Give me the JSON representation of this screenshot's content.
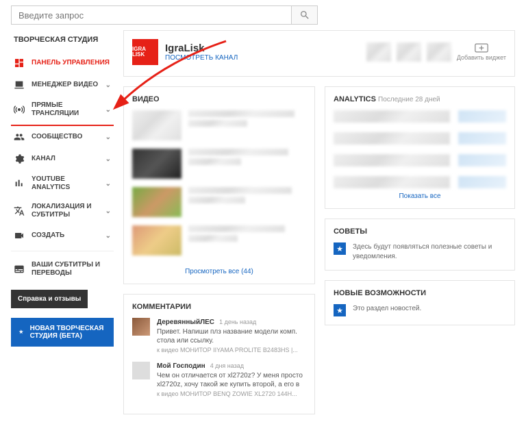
{
  "search": {
    "placeholder": "Введите запрос"
  },
  "sidebar": {
    "title": "ТВОРЧЕСКАЯ СТУДИЯ",
    "items": [
      {
        "label": "ПАНЕЛЬ УПРАВЛЕНИЯ"
      },
      {
        "label": "МЕНЕДЖЕР ВИДЕО"
      },
      {
        "label": "ПРЯМЫЕ ТРАНСЛЯЦИИ"
      },
      {
        "label": "СООБЩЕСТВО"
      },
      {
        "label": "КАНАЛ"
      },
      {
        "label": "YOUTUBE ANALYTICS"
      },
      {
        "label": "ЛОКАЛИЗАЦИЯ И СУБТИТРЫ"
      },
      {
        "label": "СОЗДАТЬ"
      },
      {
        "label": "ВАШИ СУБТИТРЫ И ПЕРЕВОДЫ"
      }
    ],
    "feedback": "Справка и отзывы",
    "newstudio": "НОВАЯ ТВОРЧЕСКАЯ СТУДИЯ (БЕТА)"
  },
  "channel": {
    "logo": "IGRA LISK",
    "name": "IgraLisk",
    "view_link": "ПОСМОТРЕТЬ КАНАЛ",
    "widget_label": "Добавить виджет"
  },
  "videos": {
    "title": "ВИДЕО",
    "view_all": "Просмотреть все (44)"
  },
  "analytics": {
    "title": "ANALYTICS",
    "subtitle": "Последние 28 дней",
    "show_all": "Показать все"
  },
  "tips": {
    "title": "СОВЕТЫ",
    "text": "Здесь будут появляться полезные советы и уведомления."
  },
  "news": {
    "title": "НОВЫЕ ВОЗМОЖНОСТИ",
    "text": "Это раздел новостей."
  },
  "comments": {
    "title": "КОММЕНТАРИИ",
    "items": [
      {
        "author": "ДеревянныйЛЕС",
        "time": "1 день назад",
        "text": "Привет. Напиши плз название модели комп. стола или ссылку.",
        "ref": "к видео МОНИТОР IIYAMA PROLITE B2483HS |..."
      },
      {
        "author": "Мой Господин",
        "time": "4 дня назад",
        "text": "Чем он отличается от xl2720z? У меня просто xl2720z, хочу такой же купить второй, а его в",
        "ref": "к видео МОНИТОР BENQ ZOWIE XL2720 144H..."
      }
    ]
  }
}
